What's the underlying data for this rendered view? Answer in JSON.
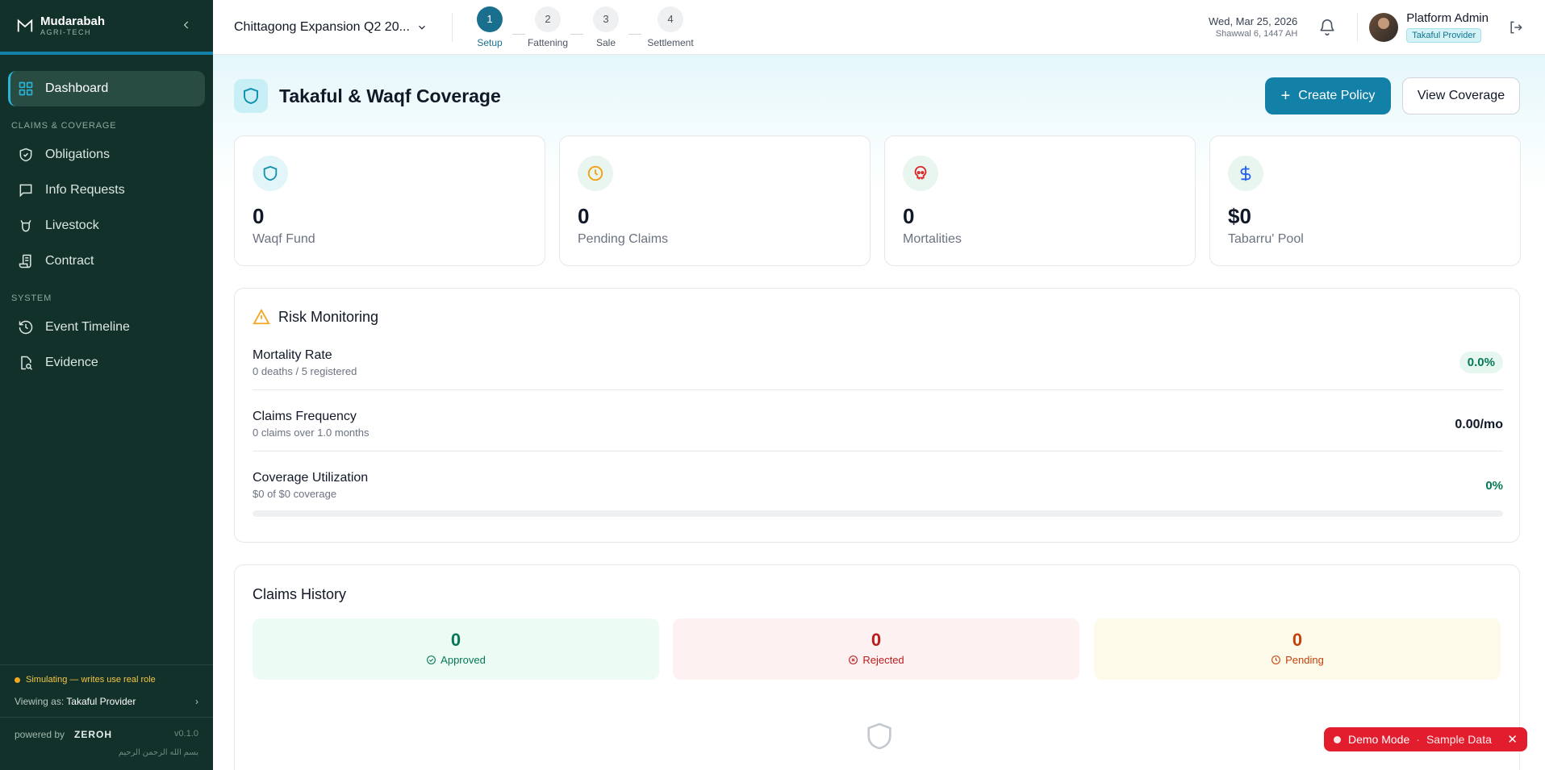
{
  "brand": {
    "name": "Mudarabah",
    "sub": "AGRI-TECH"
  },
  "sidebar": {
    "primary": {
      "label": "Dashboard"
    },
    "section1": "CLAIMS & COVERAGE",
    "items1": [
      {
        "label": "Obligations"
      },
      {
        "label": "Info Requests"
      },
      {
        "label": "Livestock"
      },
      {
        "label": "Contract"
      }
    ],
    "section2": "SYSTEM",
    "items2": [
      {
        "label": "Event Timeline"
      },
      {
        "label": "Evidence"
      }
    ],
    "sim_warning": "Simulating — writes use real role",
    "viewing_prefix": "Viewing as:",
    "viewing_role": "Takaful Provider",
    "powered_by": "powered by",
    "powered_brand": "ZEROH",
    "version": "v0.1.0",
    "bismillah": "بسم الله الرحمن الرحيم"
  },
  "topbar": {
    "project": "Chittagong Expansion Q2 20...",
    "steps": [
      {
        "num": "1",
        "label": "Setup"
      },
      {
        "num": "2",
        "label": "Fattening"
      },
      {
        "num": "3",
        "label": "Sale"
      },
      {
        "num": "4",
        "label": "Settlement"
      }
    ],
    "date": "Wed, Mar 25, 2026",
    "hijri": "Shawwal 6, 1447 AH",
    "user_name": "Platform Admin",
    "user_role": "Takaful Provider"
  },
  "page": {
    "title": "Takaful & Waqf Coverage",
    "create_label": "Create Policy",
    "view_label": "View Coverage"
  },
  "stats": [
    {
      "value": "0",
      "label": "Waqf Fund"
    },
    {
      "value": "0",
      "label": "Pending Claims"
    },
    {
      "value": "0",
      "label": "Mortalities"
    },
    {
      "value": "$0",
      "label": "Tabarru' Pool"
    }
  ],
  "risk": {
    "title": "Risk Monitoring",
    "metrics": [
      {
        "name": "Mortality Rate",
        "sub": "0 deaths / 5 registered",
        "value": "0.0%"
      },
      {
        "name": "Claims Frequency",
        "sub": "0 claims over 1.0 months",
        "value": "0.00/mo"
      },
      {
        "name": "Coverage Utilization",
        "sub": "$0 of $0 coverage",
        "value": "0%"
      }
    ],
    "utilization_fraction": 0
  },
  "claims": {
    "title": "Claims History",
    "approved": {
      "value": "0",
      "label": "Approved"
    },
    "rejected": {
      "value": "0",
      "label": "Rejected"
    },
    "pending": {
      "value": "0",
      "label": "Pending"
    }
  },
  "demo": {
    "label": "Demo Mode",
    "sub": "Sample Data",
    "close": "✕"
  },
  "colors": {
    "sidebar": "#12312a",
    "accent": "#1380a8",
    "demo": "#e11d2e"
  }
}
